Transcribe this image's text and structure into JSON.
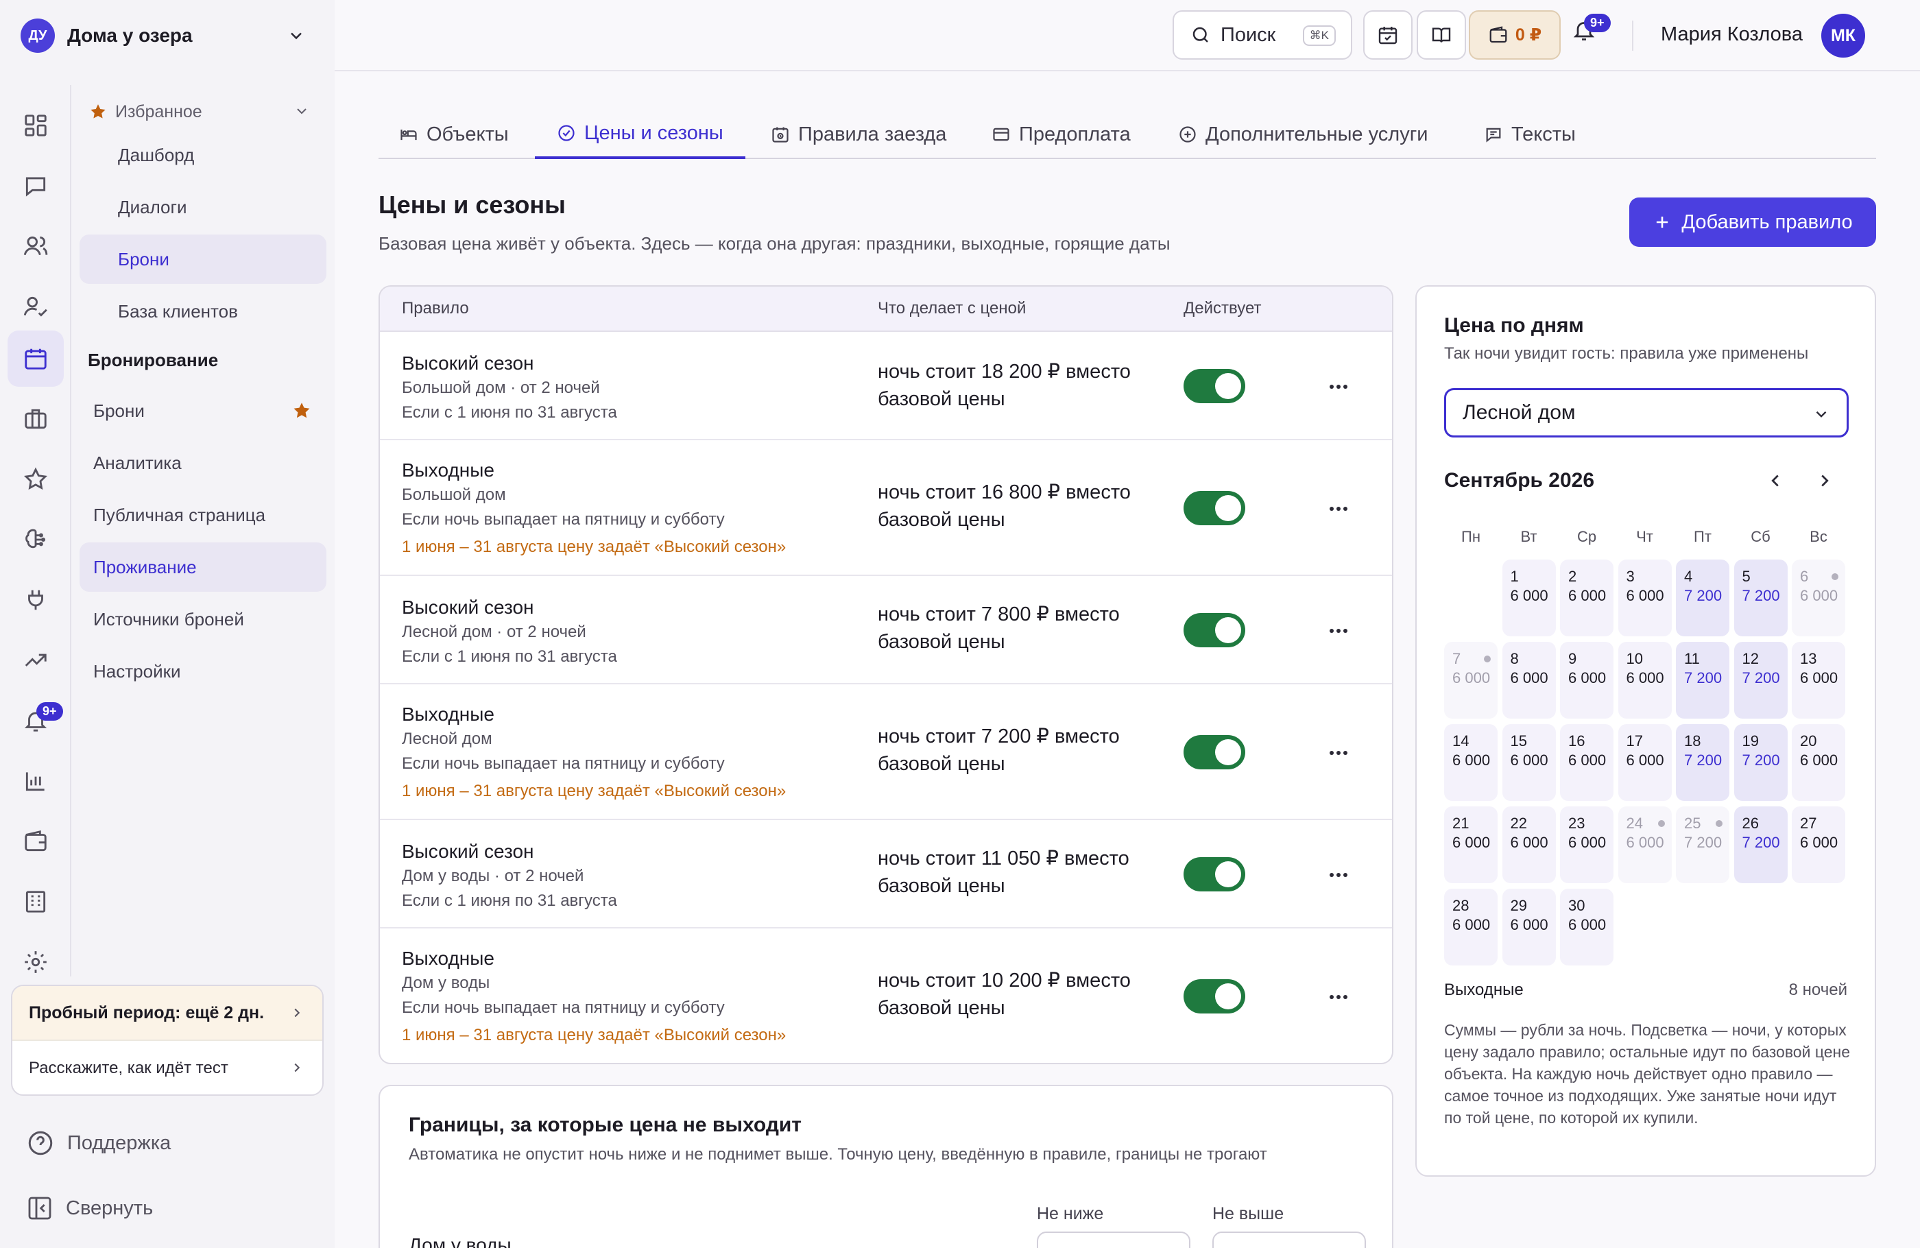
{
  "workspace": {
    "initials": "ДУ",
    "name": "Дома у озера"
  },
  "topbar": {
    "search_label": "Поиск",
    "search_shortcut": "⌘K",
    "wallet_amount": "0 ₽",
    "notif_badge": "9+",
    "user_name": "Мария Козлова",
    "user_initials": "МК"
  },
  "sidebar": {
    "favorites_label": "Избранное",
    "favorites": [
      "Дашборд",
      "Диалоги",
      "Брони",
      "База клиентов"
    ],
    "section_label": "Бронирование",
    "items": [
      "Брони",
      "Аналитика",
      "Публичная страница",
      "Проживание",
      "Источники броней",
      "Настройки"
    ],
    "rail_badge": "9+",
    "trial_label": "Пробный период: ещё 2 дн.",
    "feedback_label": "Расскажите, как идёт тест",
    "support_label": "Поддержка",
    "collapse_label": "Свернуть"
  },
  "tabs": [
    "Объекты",
    "Цены и сезоны",
    "Правила заезда",
    "Предоплата",
    "Дополнительные услуги",
    "Тексты"
  ],
  "page": {
    "title": "Цены и сезоны",
    "subtitle": "Базовая цена живёт у объекта. Здесь — когда она другая: праздники, выходные, горящие даты",
    "add_button": "Добавить правило"
  },
  "rules_table": {
    "columns": [
      "Правило",
      "Что делает с ценой",
      "Действует"
    ],
    "rows": [
      {
        "title": "Высокий сезон",
        "object": "Большой дом · от 2 ночей",
        "condition": "Если с 1 июня по 31 августа",
        "warning": "",
        "price_line1": "ночь стоит 18 200 ₽ вместо",
        "price_line2": "базовой цены",
        "active": true
      },
      {
        "title": "Выходные",
        "object": "Большой дом",
        "condition": "Если ночь выпадает на пятницу и субботу",
        "warning": "1 июня – 31 августа цену задаёт «Высокий сезон»",
        "price_line1": "ночь стоит 16 800 ₽ вместо",
        "price_line2": "базовой цены",
        "active": true
      },
      {
        "title": "Высокий сезон",
        "object": "Лесной дом · от 2 ночей",
        "condition": "Если с 1 июня по 31 августа",
        "warning": "",
        "price_line1": "ночь стоит 7 800 ₽ вместо",
        "price_line2": "базовой цены",
        "active": true
      },
      {
        "title": "Выходные",
        "object": "Лесной дом",
        "condition": "Если ночь выпадает на пятницу и субботу",
        "warning": "1 июня – 31 августа цену задаёт «Высокий сезон»",
        "price_line1": "ночь стоит 7 200 ₽ вместо",
        "price_line2": "базовой цены",
        "active": true
      },
      {
        "title": "Высокий сезон",
        "object": "Дом у воды · от 2 ночей",
        "condition": "Если с 1 июня по 31 августа",
        "warning": "",
        "price_line1": "ночь стоит 11 050 ₽ вместо",
        "price_line2": "базовой цены",
        "active": true
      },
      {
        "title": "Выходные",
        "object": "Дом у воды",
        "condition": "Если ночь выпадает на пятницу и субботу",
        "warning": "1 июня – 31 августа цену задаёт «Высокий сезон»",
        "price_line1": "ночь стоит 10 200 ₽ вместо",
        "price_line2": "базовой цены",
        "active": true
      }
    ]
  },
  "limits": {
    "title": "Границы, за которые цена не выходит",
    "subtitle": "Автоматика не опустит ночь ниже и не поднимет выше. Точную цену, введённую в правиле, границы не трогают",
    "min_label": "Не ниже",
    "max_label": "Не выше",
    "first_object": "Дом у воды"
  },
  "calendar": {
    "title": "Цена по дням",
    "subtitle": "Так ночи увидит гость: правила уже применены",
    "selected_object": "Лесной дом",
    "month": "Сентябрь 2026",
    "weekdays": [
      "Пн",
      "Вт",
      "Ср",
      "Чт",
      "Пт",
      "Сб",
      "Вс"
    ],
    "days": [
      {
        "d": "1",
        "price": "6 000",
        "state": "base"
      },
      {
        "d": "2",
        "price": "6 000",
        "state": "base"
      },
      {
        "d": "3",
        "price": "6 000",
        "state": "base"
      },
      {
        "d": "4",
        "price": "7 200",
        "state": "rule"
      },
      {
        "d": "5",
        "price": "7 200",
        "state": "rule"
      },
      {
        "d": "6",
        "price": "6 000",
        "state": "booked"
      },
      {
        "d": "7",
        "price": "6 000",
        "state": "booked"
      },
      {
        "d": "8",
        "price": "6 000",
        "state": "base"
      },
      {
        "d": "9",
        "price": "6 000",
        "state": "base"
      },
      {
        "d": "10",
        "price": "6 000",
        "state": "base"
      },
      {
        "d": "11",
        "price": "7 200",
        "state": "rule"
      },
      {
        "d": "12",
        "price": "7 200",
        "state": "rule"
      },
      {
        "d": "13",
        "price": "6 000",
        "state": "base"
      },
      {
        "d": "14",
        "price": "6 000",
        "state": "base"
      },
      {
        "d": "15",
        "price": "6 000",
        "state": "base"
      },
      {
        "d": "16",
        "price": "6 000",
        "state": "base"
      },
      {
        "d": "17",
        "price": "6 000",
        "state": "base"
      },
      {
        "d": "18",
        "price": "7 200",
        "state": "rule"
      },
      {
        "d": "19",
        "price": "7 200",
        "state": "rule"
      },
      {
        "d": "20",
        "price": "6 000",
        "state": "base"
      },
      {
        "d": "21",
        "price": "6 000",
        "state": "base"
      },
      {
        "d": "22",
        "price": "6 000",
        "state": "base"
      },
      {
        "d": "23",
        "price": "6 000",
        "state": "base"
      },
      {
        "d": "24",
        "price": "6 000",
        "state": "booked"
      },
      {
        "d": "25",
        "price": "7 200",
        "state": "booked"
      },
      {
        "d": "26",
        "price": "7 200",
        "state": "rule"
      },
      {
        "d": "27",
        "price": "6 000",
        "state": "base"
      },
      {
        "d": "28",
        "price": "6 000",
        "state": "base"
      },
      {
        "d": "29",
        "price": "6 000",
        "state": "base"
      },
      {
        "d": "30",
        "price": "6 000",
        "state": "base"
      }
    ],
    "first_weekday": 1,
    "legend_label": "Выходные",
    "legend_value": "8 ночей",
    "note": "Суммы — рубли за ночь. Подсветка — ночи, у которых цену задало правило; остальные идут по базовой цене объекта. На каждую ночь действует одно правило — самое точное из подходящих. Уже занятые ночи идут по той цене, по которой их купили."
  },
  "colors": {
    "accent": "#3d2fd0",
    "toggle_on": "#1f7a3f",
    "warning": "#c36a12",
    "favorite_star": "#c0600e"
  }
}
